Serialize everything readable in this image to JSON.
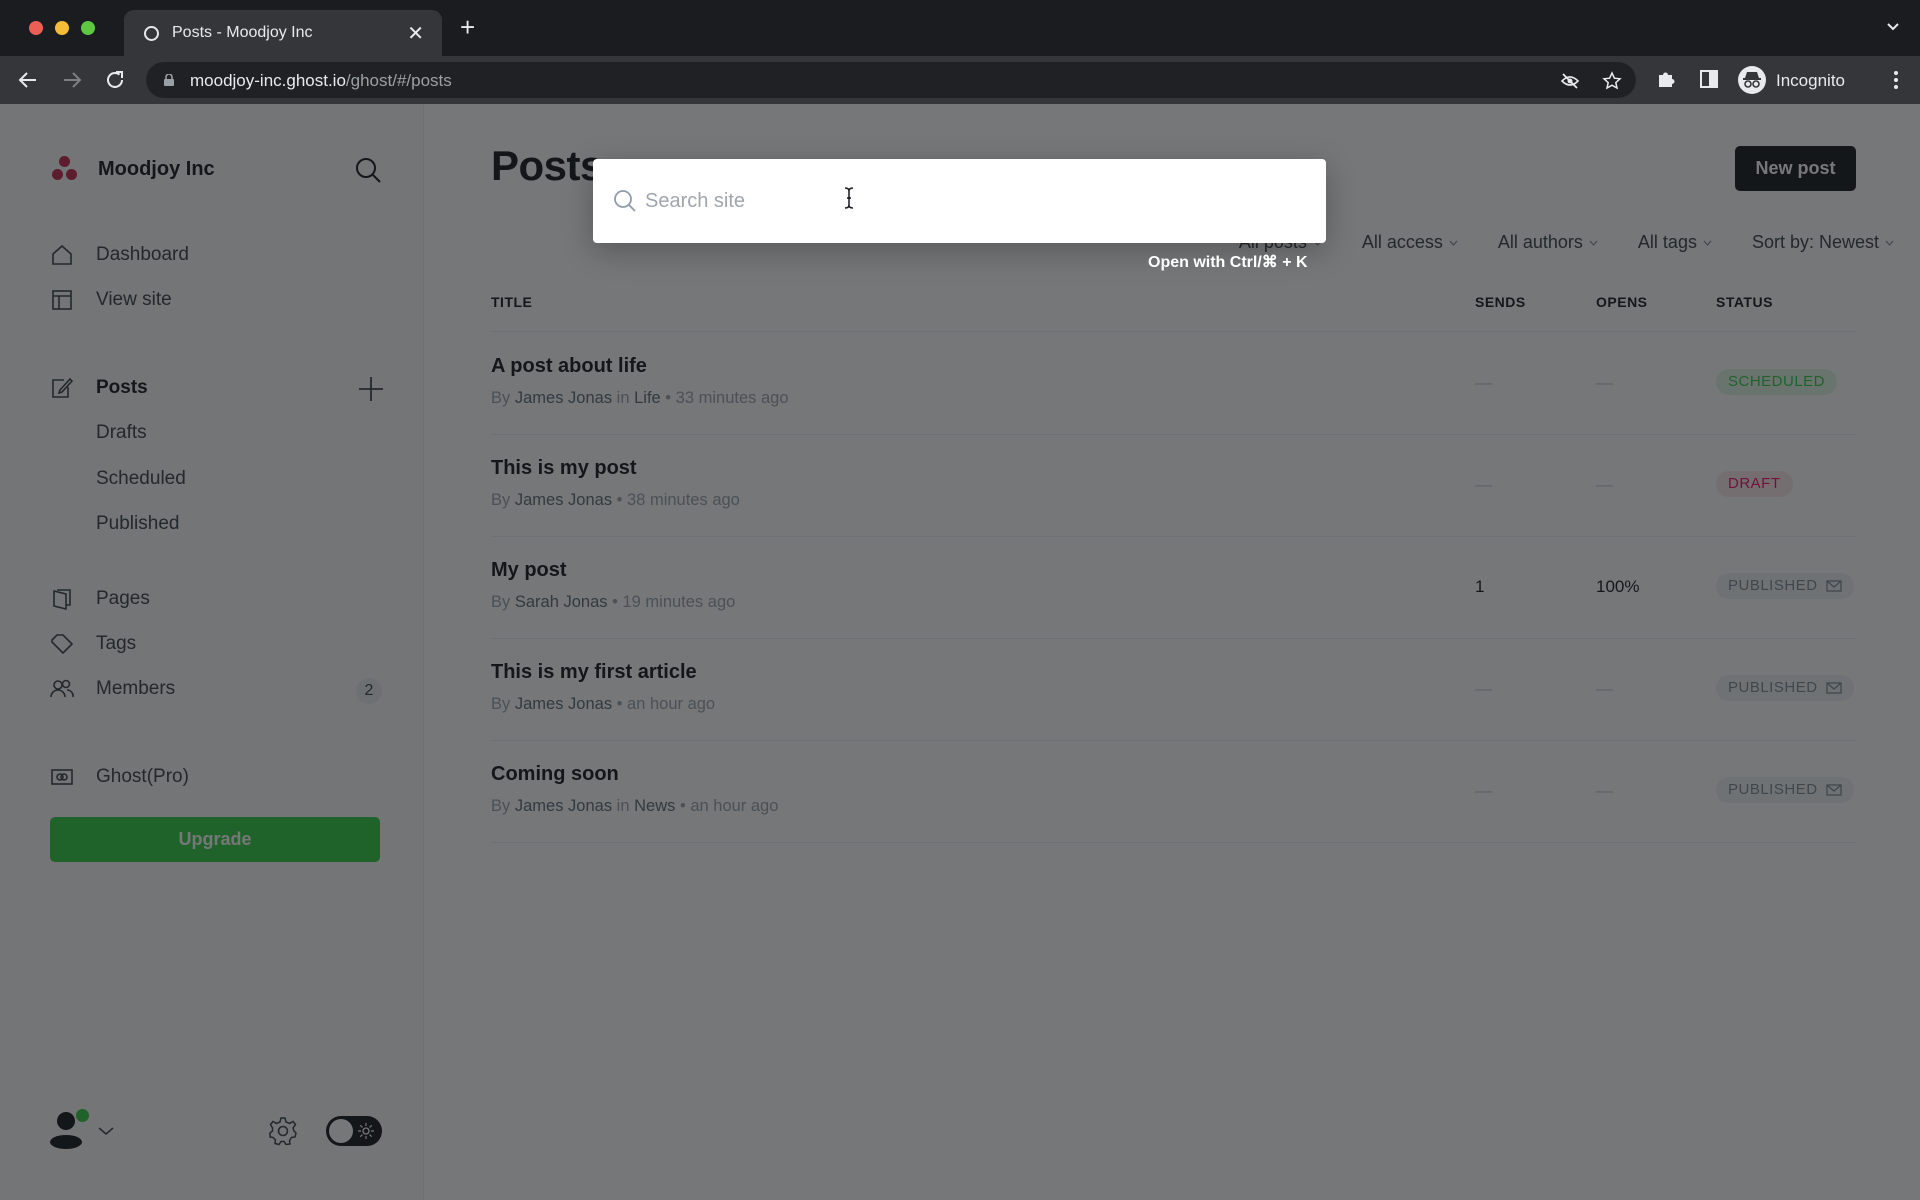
{
  "browser": {
    "tab_title": "Posts - Moodjoy Inc",
    "url_host": "moodjoy-inc.ghost.io",
    "url_path": "/ghost/#/posts",
    "profile_label": "Incognito"
  },
  "sidebar": {
    "site_name": "Moodjoy Inc",
    "items": [
      {
        "label": "Dashboard",
        "icon": "home-icon"
      },
      {
        "label": "View site",
        "icon": "layout-icon"
      },
      {
        "label": "Posts",
        "icon": "edit-icon"
      },
      {
        "label": "Drafts"
      },
      {
        "label": "Scheduled"
      },
      {
        "label": "Published"
      },
      {
        "label": "Pages",
        "icon": "pages-icon"
      },
      {
        "label": "Tags",
        "icon": "tag-icon"
      },
      {
        "label": "Members",
        "icon": "members-icon",
        "count": "2"
      },
      {
        "label": "Ghost(Pro)",
        "icon": "ghost-pro-icon"
      }
    ],
    "upgrade_label": "Upgrade"
  },
  "main": {
    "title": "Posts",
    "new_post_label": "New post",
    "filters": [
      "All posts",
      "All access",
      "All authors",
      "All tags",
      "Sort by: Newest"
    ],
    "columns": {
      "title": "TITLE",
      "sends": "SENDS",
      "opens": "OPENS",
      "status": "STATUS"
    },
    "posts": [
      {
        "title": "A post about life",
        "by": "By",
        "author": "James Jonas",
        "in": "in",
        "tag": "Life",
        "time": "33 minutes ago",
        "sends": "—",
        "opens": "—",
        "status": "SCHEDULED"
      },
      {
        "title": "This is my post",
        "by": "By",
        "author": "James Jonas",
        "in": "",
        "tag": "",
        "time": "38 minutes ago",
        "sends": "—",
        "opens": "—",
        "status": "DRAFT"
      },
      {
        "title": "My post",
        "by": "By",
        "author": "Sarah Jonas",
        "in": "",
        "tag": "",
        "time": "19 minutes ago",
        "sends": "1",
        "opens": "100%",
        "status": "PUBLISHED"
      },
      {
        "title": "This is my first article",
        "by": "By",
        "author": "James Jonas",
        "in": "",
        "tag": "",
        "time": "an hour ago",
        "sends": "—",
        "opens": "—",
        "status": "PUBLISHED"
      },
      {
        "title": "Coming soon",
        "by": "By",
        "author": "James Jonas",
        "in": "in",
        "tag": "News",
        "time": "an hour ago",
        "sends": "—",
        "opens": "—",
        "status": "PUBLISHED"
      }
    ]
  },
  "search": {
    "placeholder": "Search site",
    "value": "",
    "hint": "Open with Ctrl/⌘ + K"
  },
  "colors": {
    "accent_green": "#30cf43",
    "draft_pink": "#f50b6b",
    "brand_red": "#c5254f",
    "dark": "#15171a"
  }
}
